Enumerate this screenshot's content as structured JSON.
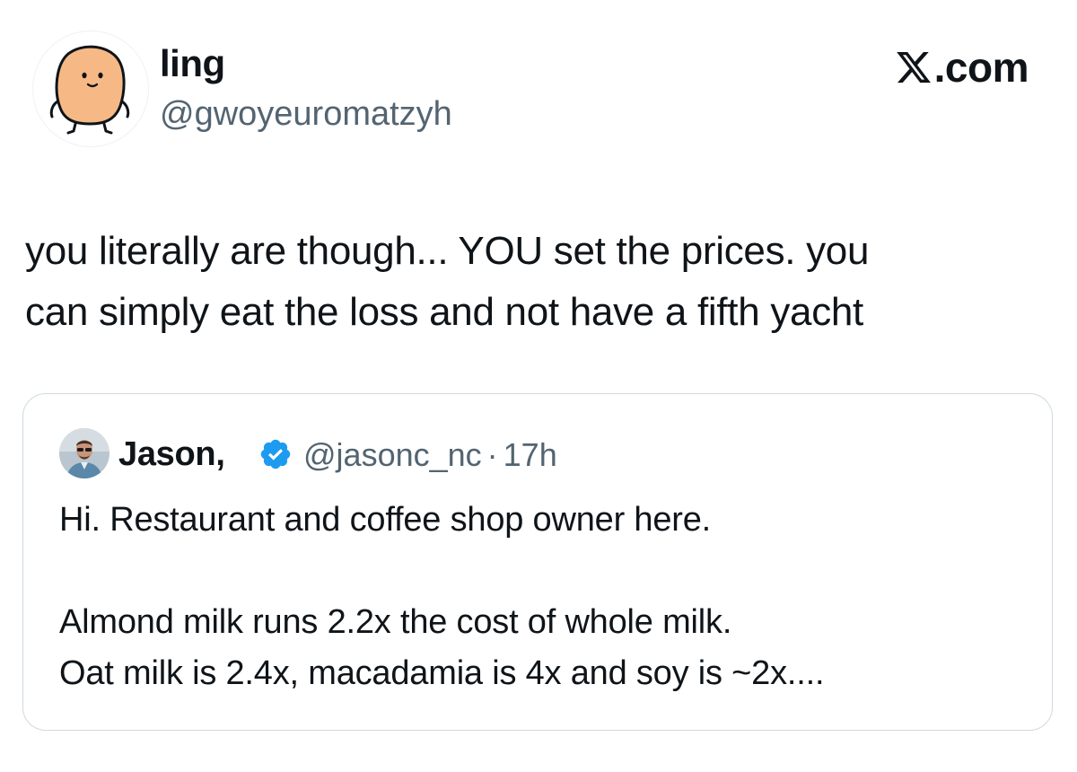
{
  "author": {
    "name": "ling",
    "handle": "@gwoyeuromatzyh",
    "avatar_icon": "potato-character-avatar"
  },
  "brand": {
    "label": ".com",
    "icon": "x-logo-icon"
  },
  "tweet": {
    "line1": "you literally are though... YOU set the prices. you",
    "line2": "can simply eat the loss and not have a fifth yacht"
  },
  "quote": {
    "name": "Jason,",
    "verified_icon": "verified-badge-icon",
    "handle": "@jasonc_nc",
    "separator": "·",
    "time": "17h",
    "line1": "Hi. Restaurant and coffee shop owner here.",
    "line2": "Almond milk runs 2.2x the cost of whole milk.",
    "line3": "Oat milk is 2.4x, macadamia is 4x and soy is ~2x...."
  },
  "colors": {
    "text": "#0f1419",
    "secondary": "#536471",
    "verified": "#1d9bf0",
    "border": "#cfd9de",
    "avatar_potato": "#f6b985"
  }
}
